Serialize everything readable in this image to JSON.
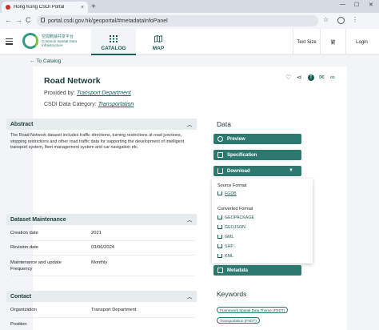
{
  "browser": {
    "tab_title": "Hong Kong CSDI Portal",
    "tab_close": "×",
    "new_tab": "+",
    "url": "portal.csdi.gov.hk/geoportal/#metadataInfoPanel",
    "back": "←",
    "forward": "→",
    "reload": "C",
    "minimize": "—",
    "maximize": "☐",
    "close": "✕",
    "star": "☆",
    "menu": "⋮"
  },
  "header": {
    "logo_cn": "空間數據共享平台",
    "logo_en": "Common Spatial Data Infrastructure",
    "tabs": [
      {
        "label": "CATALOG",
        "icon": "grid-icon",
        "active": true
      },
      {
        "label": "MAP",
        "icon": "map-icon",
        "active": false
      }
    ],
    "text_size": "Text Size",
    "lang": "繁",
    "login": "Login"
  },
  "back_link": "To Catalog",
  "dataset": {
    "title": "Road Network",
    "provided_by_label": "Provided by:",
    "provided_by": "Transport Department",
    "category_label": "CSDI Data Category:",
    "category": "Transportation"
  },
  "abstract": {
    "heading": "Abstract",
    "text": "The Road Network dataset includes traffic directions, turning restrictions at road junctions, stopping restrictions and other road traffic data for supporting the development of intelligent transport system, fleet management system and car navigation etc."
  },
  "maintenance": {
    "heading": "Dataset Maintenance",
    "rows": [
      {
        "k": "Creation date",
        "v": "2021"
      },
      {
        "k": "Revision date",
        "v": "03/06/2024"
      },
      {
        "k": "Maintenance and update Frequency",
        "v": "Monthly"
      }
    ]
  },
  "contact": {
    "heading": "Contact",
    "rows": [
      {
        "k": "Organization",
        "v": "Transport Department"
      },
      {
        "k": "Position",
        "v": ""
      }
    ]
  },
  "data_panel": {
    "heading": "Data",
    "preview": "Preview",
    "specification": "Specification",
    "download": "Download",
    "source_format_label": "Source Format",
    "source_formats": [
      "FGDB"
    ],
    "converted_format_label": "Converted Format",
    "converted_formats": [
      "GEOPACKAGE",
      "GEOJSON",
      "GML",
      "SHP",
      "KML"
    ],
    "metadata": "Metadata"
  },
  "keywords": {
    "heading": "Keywords",
    "tags": [
      "Framework Spatial Data Theme (FSDT)",
      "Transportation (FSDT)"
    ]
  },
  "colors": {
    "accent": "#2c7a6f",
    "brand": "#1d5c56"
  }
}
